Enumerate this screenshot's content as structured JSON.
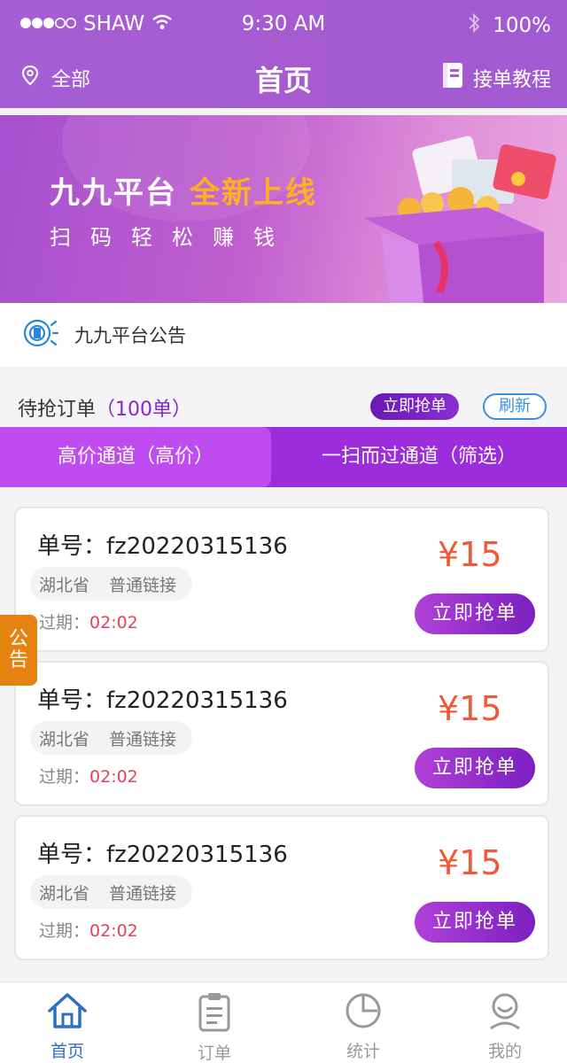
{
  "status_bar": {
    "carrier": "SHAW",
    "time": "9:30 AM",
    "battery": "100%",
    "icons": [
      "signal-dots-icon",
      "wifi-icon",
      "bluetooth-icon",
      "battery-icon"
    ]
  },
  "nav": {
    "location_label": "全部",
    "title": "首页",
    "tutorial_label": "接单教程"
  },
  "banner": {
    "title": "九九平台",
    "highlight": "全新上线",
    "subtitle": "扫码轻松赚钱"
  },
  "notice": {
    "text": "九九平台公告"
  },
  "orders": {
    "title": "待抢订单",
    "count": "（100单）",
    "grab_all_label": "立即抢单",
    "refresh_label": "刷新"
  },
  "channels": {
    "high": "高价通道（高价）",
    "fast": "一扫而过通道（筛选）"
  },
  "order_cards": [
    {
      "number": "单号：fz20220315136",
      "province": "湖北省",
      "type": "普通链接",
      "expire_label": "过期：",
      "expire_time": "02:02",
      "price": "¥15",
      "button": "立即抢单"
    },
    {
      "number": "单号：fz20220315136",
      "province": "湖北省",
      "type": "普通链接",
      "expire_label": "过期：",
      "expire_time": "02:02",
      "price": "¥15",
      "button": "立即抢单"
    },
    {
      "number": "单号：fz20220315136",
      "province": "湖北省",
      "type": "普通链接",
      "expire_label": "过期：",
      "expire_time": "02:02",
      "price": "¥15",
      "button": "立即抢单"
    }
  ],
  "side_notice": {
    "char1": "公",
    "char2": "告"
  },
  "tabbar": {
    "home": "首页",
    "orders": "订单",
    "stats": "统计",
    "mine": "我的"
  },
  "colors": {
    "header": "#a65bd0",
    "accent_purple": "#9b2ddc",
    "price": "#ee5a3a",
    "active_tab": "#2d6fc0",
    "side_notice": "#e6820f"
  }
}
